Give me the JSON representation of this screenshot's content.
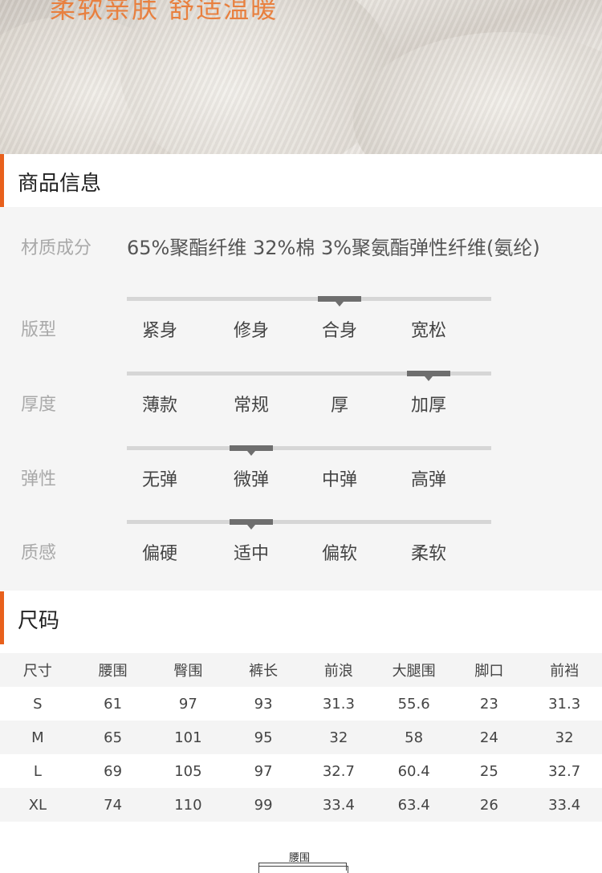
{
  "hero": {
    "title": "柔软亲肤 舒适温暖"
  },
  "product_info": {
    "heading": "商品信息",
    "material": {
      "label": "材质成分",
      "value": "65%聚酯纤维 32%棉 3%聚氨酯弹性纤维(氨纶)"
    },
    "attributes": [
      {
        "label": "版型",
        "options": [
          "紧身",
          "修身",
          "合身",
          "宽松"
        ],
        "selected_index": 2
      },
      {
        "label": "厚度",
        "options": [
          "薄款",
          "常规",
          "厚",
          "加厚"
        ],
        "selected_index": 3
      },
      {
        "label": "弹性",
        "options": [
          "无弹",
          "微弹",
          "中弹",
          "高弹"
        ],
        "selected_index": 1
      },
      {
        "label": "质感",
        "options": [
          "偏硬",
          "适中",
          "偏软",
          "柔软"
        ],
        "selected_index": 1
      }
    ]
  },
  "size_chart": {
    "heading": "尺码",
    "columns": [
      "尺寸",
      "腰围",
      "臀围",
      "裤长",
      "前浪",
      "大腿围",
      "脚口",
      "前裆"
    ],
    "rows": [
      [
        "S",
        "61",
        "97",
        "93",
        "31.3",
        "55.6",
        "23",
        "31.3"
      ],
      [
        "M",
        "65",
        "101",
        "95",
        "32",
        "58",
        "24",
        "32"
      ],
      [
        "L",
        "69",
        "105",
        "97",
        "32.7",
        "60.4",
        "25",
        "32.7"
      ],
      [
        "XL",
        "74",
        "110",
        "99",
        "33.4",
        "63.4",
        "26",
        "33.4"
      ]
    ]
  },
  "diagram": {
    "label": "腰围"
  },
  "colors": {
    "accent": "#e8601c",
    "hero_text": "#e8803f",
    "marker": "#6e6e6e"
  }
}
